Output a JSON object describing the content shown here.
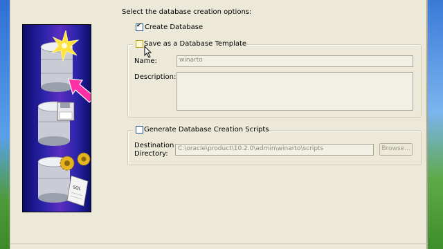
{
  "header": {
    "instruction": "Select the database creation options:"
  },
  "options": {
    "create_database": {
      "label": "Create Database",
      "checked": true
    },
    "save_template": {
      "label": "Save as a Database Template",
      "checked": false,
      "name_label": "Name:",
      "name_value": "winarto",
      "description_label": "Description:",
      "description_value": ""
    },
    "generate_scripts": {
      "label": "Generate Database Creation Scripts",
      "checked": false,
      "destination_label_1": "Destination",
      "destination_label_2": "Directory:",
      "destination_value": "C:\\oracle\\product\\10.2.0\\admin\\winarto\\scripts",
      "browse_label": "Browse..."
    }
  },
  "colors": {
    "accent_pink": "#ff2fa8",
    "image_blue": "#2a23a8",
    "window_bg": "#ece9d8"
  }
}
